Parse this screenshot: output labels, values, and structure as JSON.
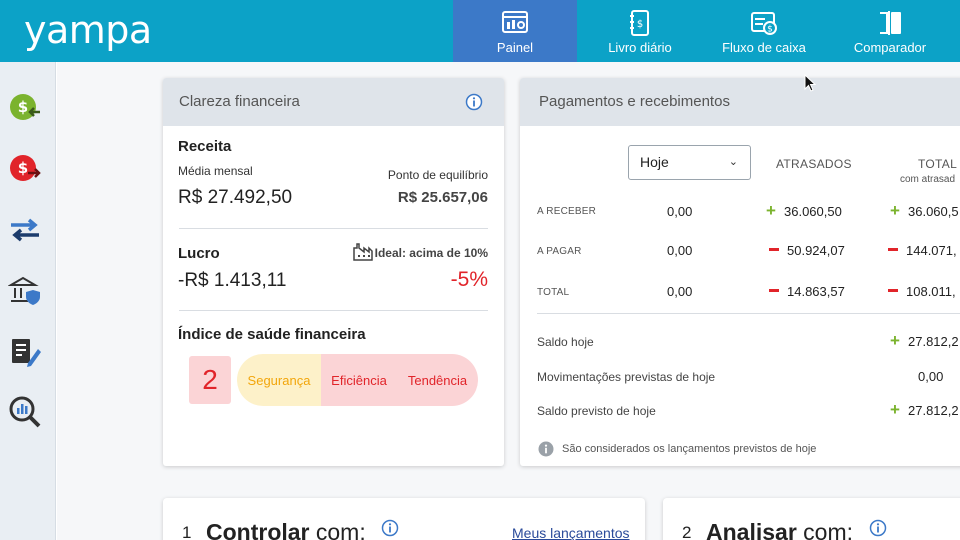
{
  "app": {
    "logo": "yampa"
  },
  "nav": [
    {
      "label": "Painel",
      "icon": "dashboard-icon",
      "active": true
    },
    {
      "label": "Livro diário",
      "icon": "journal-book-icon",
      "active": false
    },
    {
      "label": "Fluxo de caixa",
      "icon": "cash-flow-icon",
      "active": false
    },
    {
      "label": "Comparador",
      "icon": "compare-icon",
      "active": false
    }
  ],
  "sidebar": [
    {
      "icon": "money-in-icon",
      "color": "#7bb32e"
    },
    {
      "icon": "money-out-icon",
      "color": "#e1242a"
    },
    {
      "icon": "transfer-arrows-icon",
      "color": "#3c79c8"
    },
    {
      "icon": "bank-shield-icon",
      "color": "#444444"
    },
    {
      "icon": "document-edit-icon",
      "color": "#444444"
    },
    {
      "icon": "analysis-magnifier-icon",
      "color": "#444444"
    }
  ],
  "clareza": {
    "title": "Clareza financeira",
    "receita": {
      "label": "Receita",
      "media_label": "Média mensal",
      "media_value": "R$ 27.492,50",
      "equilibrio_label": "Ponto de equilíbrio",
      "equilibrio_value": "R$ 25.657,06"
    },
    "lucro": {
      "label": "Lucro",
      "ideal_label": "Ideal: acima de 10%",
      "value": "-R$ 1.413,11",
      "percent": "-5%"
    },
    "indice": {
      "label": "Índice de saúde financeira",
      "score": "2",
      "segments": [
        "Segurança",
        "Eficiência",
        "Tendência"
      ]
    }
  },
  "pagamentos": {
    "title": "Pagamentos e recebimentos",
    "period_select": "Hoje",
    "col_atrasados": "ATRASADOS",
    "col_total": "TOTAL",
    "col_total_sub": "com atrasad",
    "rows": [
      {
        "label": "A RECEBER",
        "hoje": "0,00",
        "atrasados": "36.060,50",
        "atrasados_sign": "plus",
        "total": "36.060,5",
        "total_sign": "plus"
      },
      {
        "label": "A PAGAR",
        "hoje": "0,00",
        "atrasados": "50.924,07",
        "atrasados_sign": "minus",
        "total": "144.071,",
        "total_sign": "minus"
      },
      {
        "label": "TOTAL",
        "hoje": "0,00",
        "atrasados": "14.863,57",
        "atrasados_sign": "minus",
        "total": "108.011,",
        "total_sign": "minus"
      }
    ],
    "saldo_hoje_label": "Saldo hoje",
    "saldo_hoje_value": "27.812,2",
    "mov_label": "Movimentações previstas de hoje",
    "mov_value": "0,00",
    "saldo_prev_label": "Saldo previsto de hoje",
    "saldo_prev_value": "27.812,2",
    "note": "São considerados os lançamentos previstos de hoje"
  },
  "controlar": {
    "num": "1",
    "bold": "Controlar",
    "rest": " com:",
    "link": "Meus lançamentos"
  },
  "analisar": {
    "num": "2",
    "bold": "Analisar",
    "rest": " com:"
  }
}
